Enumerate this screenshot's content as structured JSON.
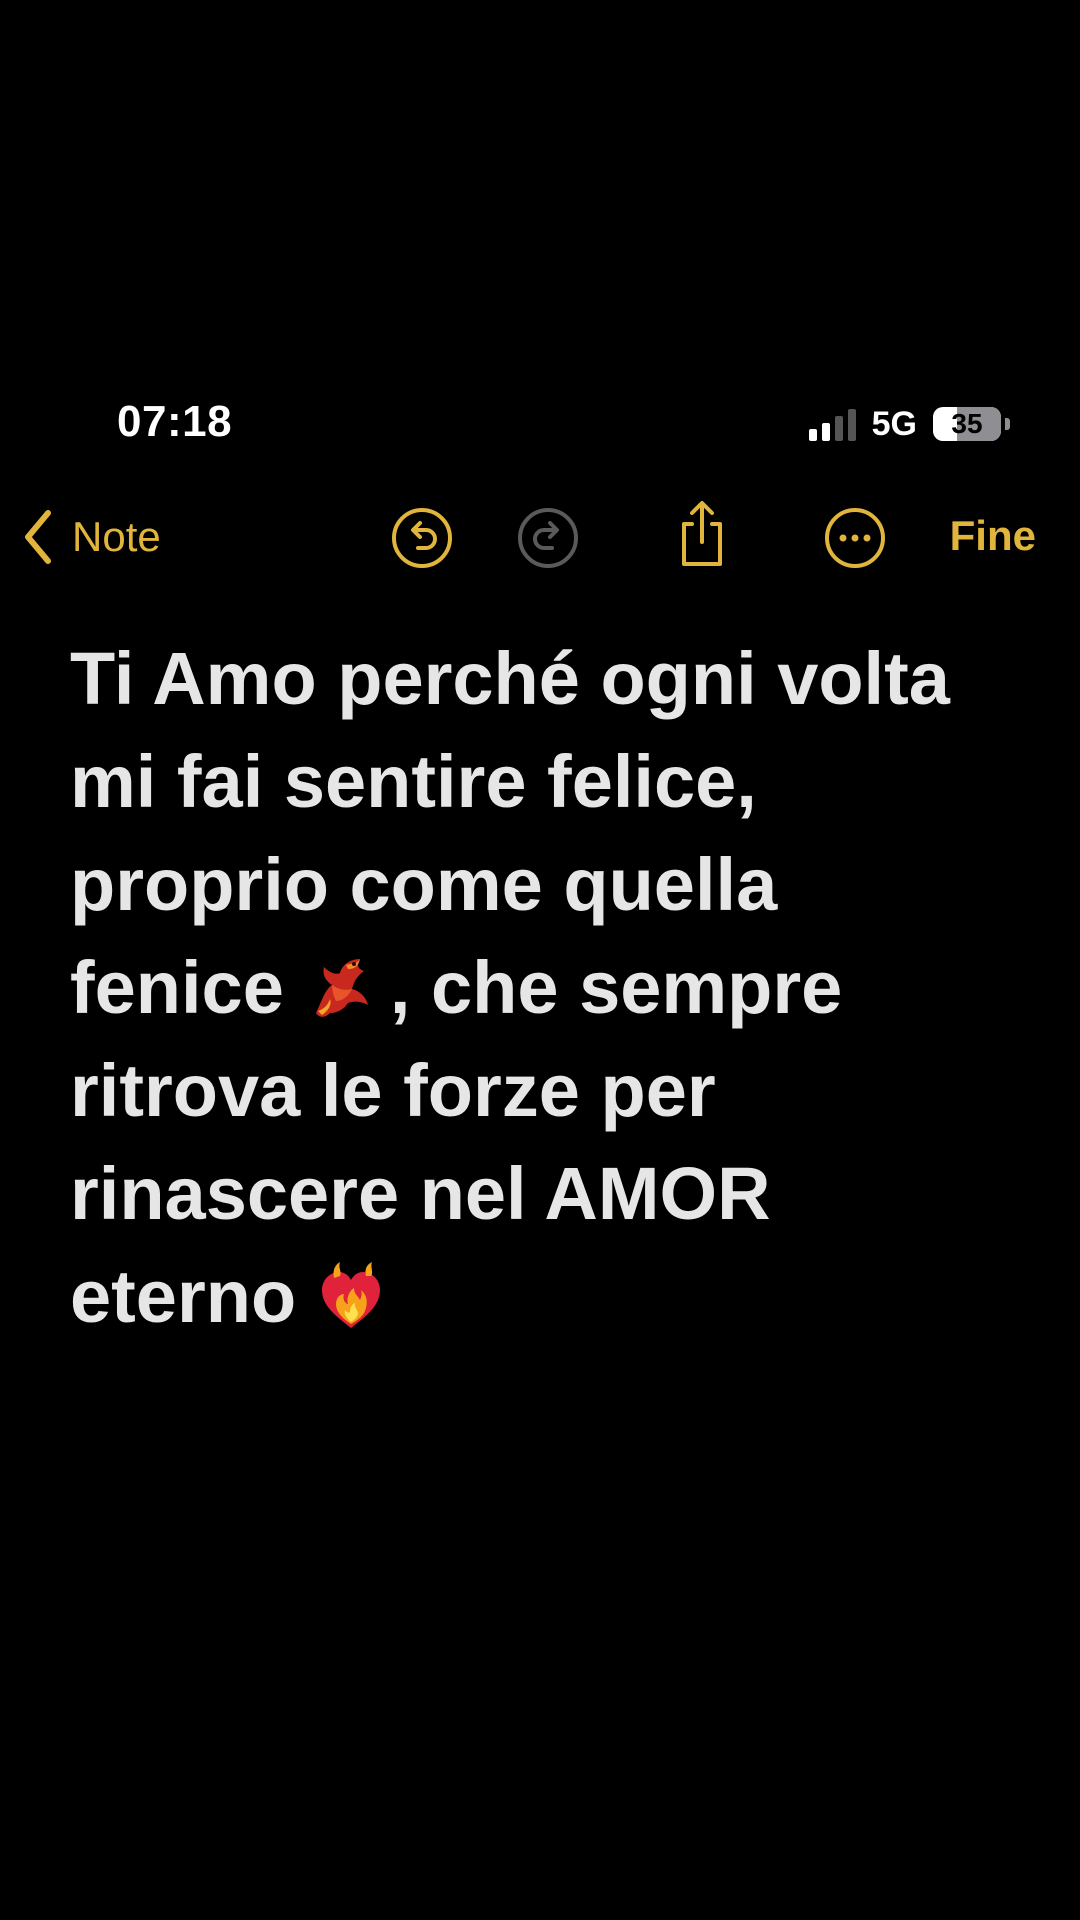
{
  "status_bar": {
    "time": "07:18",
    "network": "5G",
    "battery_level": "35"
  },
  "toolbar": {
    "back_label": "Note",
    "done_label": "Fine",
    "icons": [
      "chevron-left-icon",
      "undo-icon",
      "redo-icon",
      "share-icon",
      "more-icon"
    ],
    "accent_color": "#e1b53c",
    "disabled_color": "#5a5a5a"
  },
  "note": {
    "lines": [
      {
        "text": "Ti Amo perché ogni volta"
      },
      {
        "text": "mi fai sentire felice,"
      },
      {
        "text": "proprio come quella"
      },
      {
        "before": "fenice",
        "after": ", che sempre",
        "emoji": "phoenix-emoji-icon"
      },
      {
        "text": "ritrova le forze per"
      },
      {
        "text": "rinascere nel AMOR"
      },
      {
        "before": "eterno",
        "emoji": "heart-on-fire-emoji-icon"
      }
    ],
    "text_color": "#e6e6e6"
  }
}
